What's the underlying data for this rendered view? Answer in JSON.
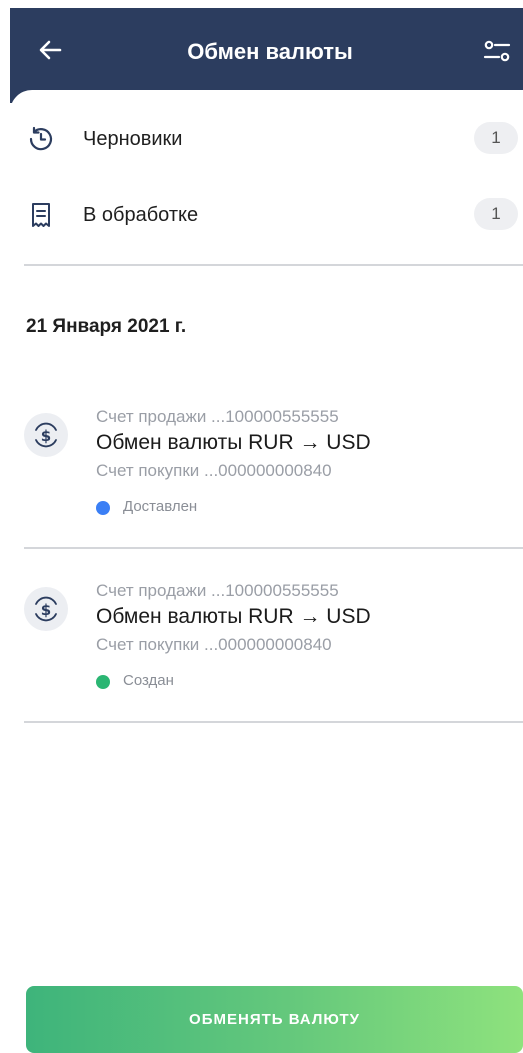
{
  "header": {
    "title": "Обмен валюты",
    "back_icon": "arrow-left-icon",
    "filter_icon": "sliders-icon",
    "background": "#2c3d5f"
  },
  "menu": [
    {
      "label": "Черновики",
      "count": "1",
      "icon": "clock-icon"
    },
    {
      "label": "В обработке",
      "count": "1",
      "icon": "receipt-icon"
    }
  ],
  "date_header": "21 Января 2021 г.",
  "operations": [
    {
      "sell_account": "Счет продажи ...100000555555",
      "title": "Обмен валюты RUR → USD",
      "buy_account": "Счет покупки ...000000000840",
      "status": "Доставлен",
      "status_color": "#3b7ff5",
      "icon": "currency-exchange-icon"
    },
    {
      "sell_account": "Счет продажи ...100000555555",
      "title": "Обмен валюты RUR → USD",
      "buy_account": "Счет покупки ...000000000840",
      "status": "Создан",
      "status_color": "#2bb673",
      "icon": "currency-exchange-icon"
    }
  ],
  "action_button": {
    "label": "ОБМЕНЯТЬ ВАЛЮТУ",
    "gradient": [
      "#3eb47b",
      "#8ee27d"
    ]
  }
}
